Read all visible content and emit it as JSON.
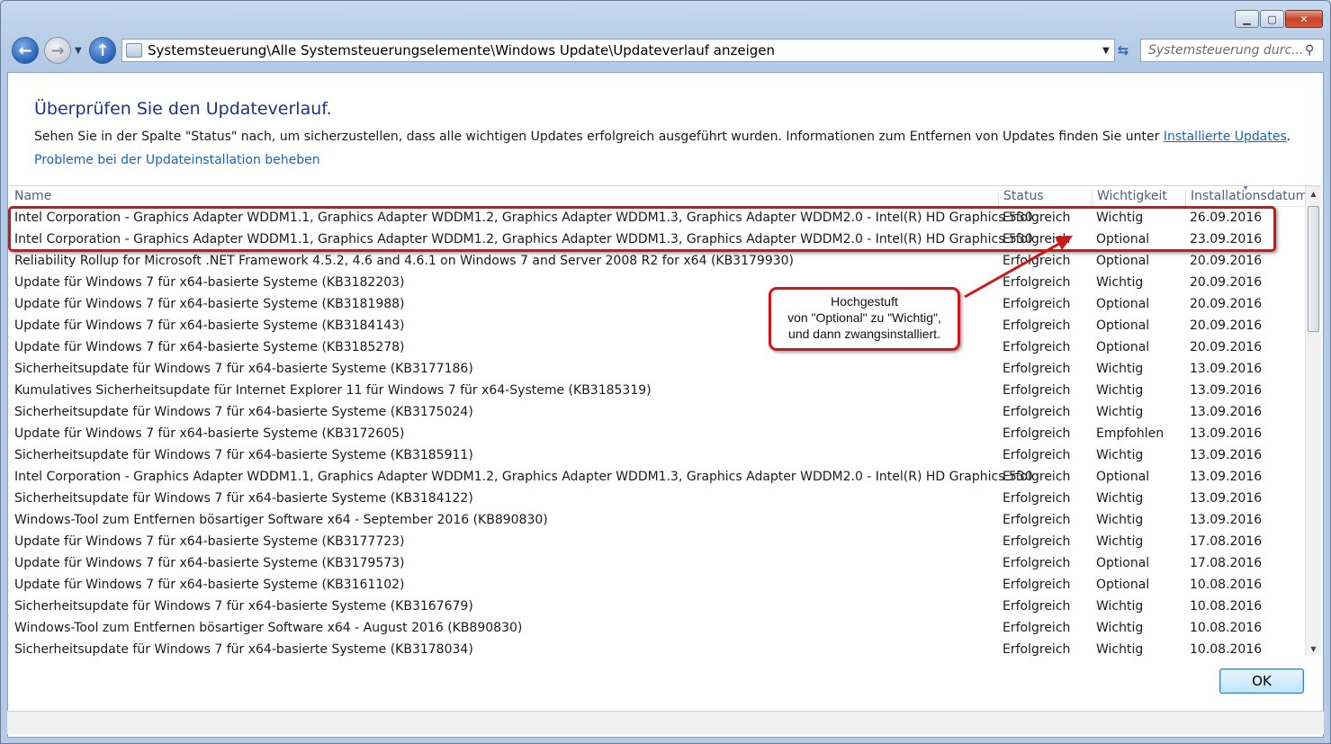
{
  "window": {
    "minimize": "▁",
    "maximize": "▢",
    "close": "✕"
  },
  "nav": {
    "back_icon": "arrow-left-icon",
    "forward_icon": "arrow-right-icon",
    "up_icon": "arrow-up-icon",
    "address": "Systemsteuerung\\Alle Systemsteuerungselemente\\Windows Update\\Updateverlauf anzeigen",
    "search_placeholder": "Systemsteuerung durc..."
  },
  "main": {
    "title": "Überprüfen Sie den Updateverlauf.",
    "description": "Sehen Sie in der Spalte \"Status\" nach, um sicherzustellen, dass alle wichtigen Updates erfolgreich ausgeführt wurden. Informationen zum Entfernen von Updates finden Sie unter ",
    "installed_updates_link": "Installierte Updates",
    "description_end": ".",
    "troubleshoot_link": "Probleme bei der Updateinstallation beheben"
  },
  "table": {
    "columns": [
      "Name",
      "Status",
      "Wichtigkeit",
      "Installationsdatum"
    ],
    "rows": [
      [
        "Intel Corporation - Graphics Adapter WDDM1.1, Graphics Adapter WDDM1.2, Graphics Adapter WDDM1.3, Graphics Adapter WDDM2.0 - Intel(R) HD Graphics 530",
        "Erfolgreich",
        "Wichtig",
        "26.09.2016"
      ],
      [
        "Intel Corporation - Graphics Adapter WDDM1.1, Graphics Adapter WDDM1.2, Graphics Adapter WDDM1.3, Graphics Adapter WDDM2.0 - Intel(R) HD Graphics 530",
        "Erfolgreich",
        "Optional",
        "23.09.2016"
      ],
      [
        "Reliability Rollup for Microsoft .NET Framework 4.5.2, 4.6 and 4.6.1 on Windows 7 and Server 2008 R2 for x64 (KB3179930)",
        "Erfolgreich",
        "Optional",
        "20.09.2016"
      ],
      [
        "Update für Windows 7 für x64-basierte Systeme (KB3182203)",
        "Erfolgreich",
        "Wichtig",
        "20.09.2016"
      ],
      [
        "Update für Windows 7 für x64-basierte Systeme (KB3181988)",
        "Erfolgreich",
        "Optional",
        "20.09.2016"
      ],
      [
        "Update für Windows 7 für x64-basierte Systeme (KB3184143)",
        "Erfolgreich",
        "Optional",
        "20.09.2016"
      ],
      [
        "Update für Windows 7 für x64-basierte Systeme (KB3185278)",
        "Erfolgreich",
        "Optional",
        "20.09.2016"
      ],
      [
        "Sicherheitsupdate für Windows 7 für x64-basierte Systeme (KB3177186)",
        "Erfolgreich",
        "Wichtig",
        "13.09.2016"
      ],
      [
        "Kumulatives Sicherheitsupdate für Internet Explorer 11 für Windows 7 für x64-Systeme (KB3185319)",
        "Erfolgreich",
        "Wichtig",
        "13.09.2016"
      ],
      [
        "Sicherheitsupdate für Windows 7 für x64-basierte Systeme (KB3175024)",
        "Erfolgreich",
        "Wichtig",
        "13.09.2016"
      ],
      [
        "Update für Windows 7 für x64-basierte Systeme (KB3172605)",
        "Erfolgreich",
        "Empfohlen",
        "13.09.2016"
      ],
      [
        "Sicherheitsupdate für Windows 7 für x64-basierte Systeme (KB3185911)",
        "Erfolgreich",
        "Wichtig",
        "13.09.2016"
      ],
      [
        "Intel Corporation - Graphics Adapter WDDM1.1, Graphics Adapter WDDM1.2, Graphics Adapter WDDM1.3, Graphics Adapter WDDM2.0 - Intel(R) HD Graphics 530",
        "Erfolgreich",
        "Optional",
        "13.09.2016"
      ],
      [
        "Sicherheitsupdate für Windows 7 für x64-basierte Systeme (KB3184122)",
        "Erfolgreich",
        "Wichtig",
        "13.09.2016"
      ],
      [
        "Windows-Tool zum Entfernen bösartiger Software x64 - September 2016 (KB890830)",
        "Erfolgreich",
        "Wichtig",
        "13.09.2016"
      ],
      [
        "Update für Windows 7 für x64-basierte Systeme (KB3177723)",
        "Erfolgreich",
        "Wichtig",
        "17.08.2016"
      ],
      [
        "Update für Windows 7 für x64-basierte Systeme (KB3179573)",
        "Erfolgreich",
        "Optional",
        "17.08.2016"
      ],
      [
        "Update für Windows 7 für x64-basierte Systeme (KB3161102)",
        "Erfolgreich",
        "Optional",
        "10.08.2016"
      ],
      [
        "Sicherheitsupdate für Windows 7 für x64-basierte Systeme (KB3167679)",
        "Erfolgreich",
        "Wichtig",
        "10.08.2016"
      ],
      [
        "Windows-Tool zum Entfernen bösartiger Software x64 - August 2016 (KB890830)",
        "Erfolgreich",
        "Wichtig",
        "10.08.2016"
      ],
      [
        "Sicherheitsupdate für Windows 7 für x64-basierte Systeme (KB3178034)",
        "Erfolgreich",
        "Wichtig",
        "10.08.2016"
      ]
    ]
  },
  "buttons": {
    "ok": "OK"
  },
  "annotation": {
    "line1": "Hochgestuft",
    "line2": "von \"Optional\" zu \"Wichtig\",",
    "line3": "und dann zwangsinstalliert.",
    "color": "#d01717"
  }
}
